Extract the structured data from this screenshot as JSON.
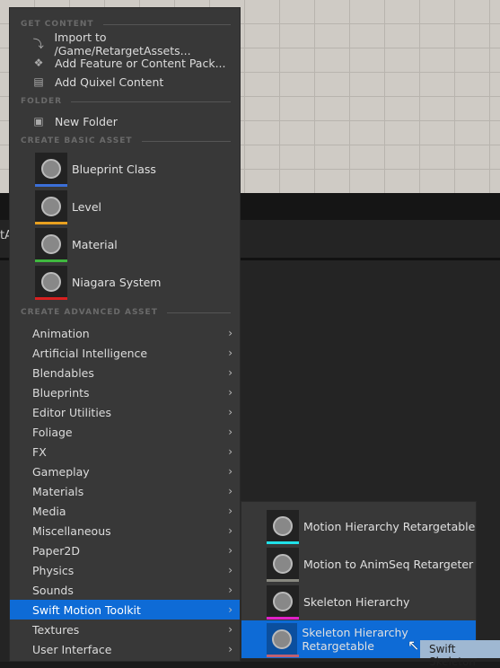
{
  "background": {
    "partial_label": "tA"
  },
  "menu": {
    "sections": {
      "get_content": "GET CONTENT",
      "folder": "FOLDER",
      "basic": "CREATE BASIC ASSET",
      "advanced": "CREATE ADVANCED ASSET"
    },
    "get_content": [
      {
        "label": "Import to /Game/RetargetAssets...",
        "icon": "import-icon"
      },
      {
        "label": "Add Feature or Content Pack...",
        "icon": "feature-pack-icon"
      },
      {
        "label": "Add Quixel Content",
        "icon": "quixel-icon"
      }
    ],
    "folder": [
      {
        "label": "New Folder",
        "icon": "new-folder-icon"
      }
    ],
    "basic": [
      {
        "label": "Blueprint Class",
        "color": "#3b6fd8"
      },
      {
        "label": "Level",
        "color": "#e8a020"
      },
      {
        "label": "Material",
        "color": "#3fb83f"
      },
      {
        "label": "Niagara System",
        "color": "#d82020"
      }
    ],
    "advanced": [
      "Animation",
      "Artificial Intelligence",
      "Blendables",
      "Blueprints",
      "Editor Utilities",
      "Foliage",
      "FX",
      "Gameplay",
      "Materials",
      "Media",
      "Miscellaneous",
      "Paper2D",
      "Physics",
      "Sounds",
      "Swift Motion Toolkit",
      "Textures",
      "User Interface"
    ],
    "selected_advanced": "Swift Motion Toolkit"
  },
  "submenu": {
    "items": [
      {
        "label": "Motion Hierarchy Retargetable",
        "color": "#20e0e8"
      },
      {
        "label": "Motion to AnimSeq Retargeter",
        "color": "#888880"
      },
      {
        "label": "Skeleton Hierarchy",
        "color": "#e020c8"
      },
      {
        "label": "Skeleton Hierarchy Retargetable",
        "color": "#c06070"
      }
    ],
    "selected": "Skeleton Hierarchy Retargetable"
  },
  "tooltip": "Swift Skeleton",
  "accent": "#0e6bd6"
}
